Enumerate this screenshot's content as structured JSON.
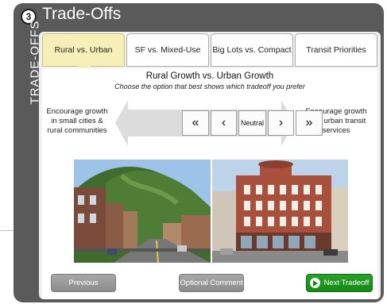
{
  "step": {
    "number": "3",
    "title": "Trade-Offs",
    "vertical_label": "TRADE-OFFS"
  },
  "tabs": [
    {
      "label": "Rural vs. Urban",
      "active": true
    },
    {
      "label": "SF vs. Mixed-Use",
      "active": false
    },
    {
      "label": "Big Lots vs. Compact",
      "active": false
    },
    {
      "label": "Transit Priorities",
      "active": false
    }
  ],
  "tradeoff": {
    "title": "Rural Growth vs. Urban Growth",
    "subtitle": "Choose the option that best shows which tradeoff you prefer",
    "left_option": "Encourage growth in small cities & rural communities",
    "right_option": "Encourage growth near urban transit services",
    "buttons": {
      "strong_left": "«",
      "left": "‹",
      "neutral": "Neutral",
      "right": "›",
      "strong_right": "»"
    }
  },
  "footer": {
    "previous": "Previous",
    "comment": "Optional Comment",
    "next": "Next Tradeoff"
  },
  "colors": {
    "panel": "#5a5a5a",
    "active_tab": "#f7efb8",
    "next_button": "#1f961f",
    "gray_button": "#999999"
  },
  "icons": [
    "arrow-circle-right-icon"
  ]
}
